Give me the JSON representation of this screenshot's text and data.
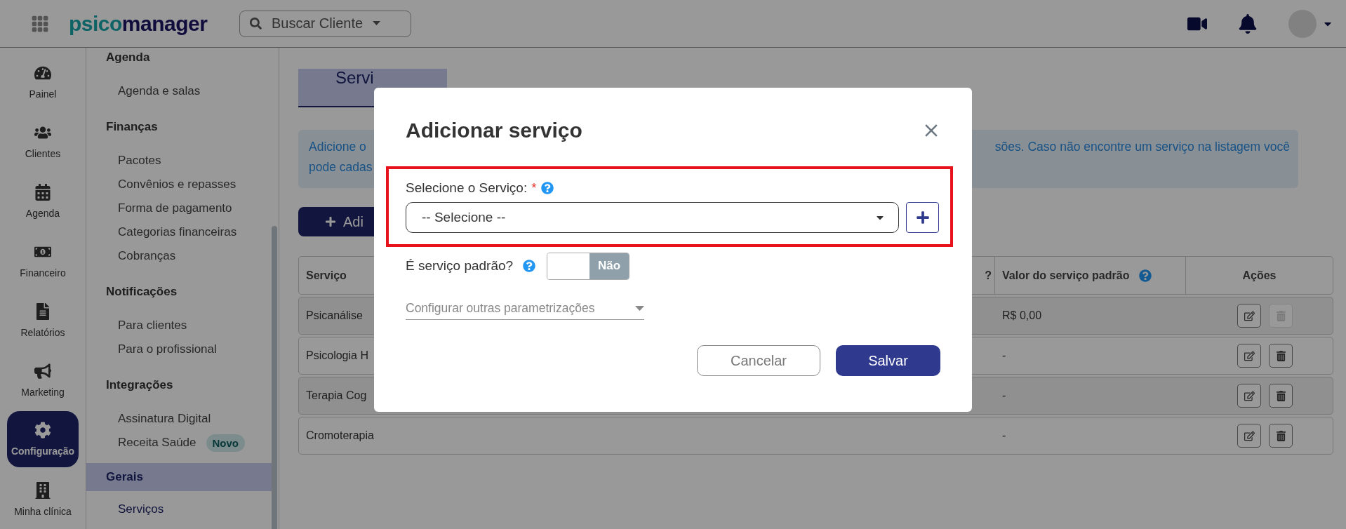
{
  "topbar": {
    "logo": {
      "lead": "psico",
      "tail": "manager"
    },
    "search": {
      "placeholder": "Buscar Cliente"
    }
  },
  "nav": [
    {
      "label": "Painel",
      "selected": false
    },
    {
      "label": "Clientes",
      "selected": false
    },
    {
      "label": "Agenda",
      "selected": false
    },
    {
      "label": "Financeiro",
      "selected": false
    },
    {
      "label": "Relatórios",
      "selected": false
    },
    {
      "label": "Marketing",
      "selected": false
    },
    {
      "label": "Configuração",
      "selected": true
    },
    {
      "label": "Minha clínica",
      "selected": false
    }
  ],
  "sidebar": [
    {
      "title": "Agenda",
      "selected": false,
      "items": [
        {
          "label": "Agenda e salas",
          "selected": false
        }
      ]
    },
    {
      "title": "Finanças",
      "selected": false,
      "items": [
        {
          "label": "Pacotes",
          "selected": false
        },
        {
          "label": "Convênios e repasses",
          "selected": false
        },
        {
          "label": "Forma de pagamento",
          "selected": false
        },
        {
          "label": "Categorias financeiras",
          "selected": false
        },
        {
          "label": "Cobranças",
          "selected": false
        }
      ]
    },
    {
      "title": "Notificações",
      "selected": false,
      "items": [
        {
          "label": "Para clientes",
          "selected": false
        },
        {
          "label": "Para o profissional",
          "selected": false
        }
      ]
    },
    {
      "title": "Integrações",
      "selected": false,
      "items": [
        {
          "label": "Assinatura Digital",
          "selected": false
        },
        {
          "label": "Receita Saúde",
          "selected": false,
          "badge": "Novo"
        }
      ]
    },
    {
      "title": "Gerais",
      "selected": true,
      "items": [
        {
          "label": "Serviços",
          "selected": true
        }
      ]
    }
  ],
  "page": {
    "tab": "Servi",
    "info_left": [
      "Adicione o",
      "pode cadas"
    ],
    "info_right": "sões. Caso não encontre um serviço na listagem você",
    "add_button": "Adi"
  },
  "table": {
    "columns": [
      {
        "label": "Serviço",
        "help": false
      },
      {
        "label": "?",
        "help": false
      },
      {
        "label": "Valor do serviço padrão",
        "help": true
      },
      {
        "label": "Ações",
        "help": false
      }
    ],
    "rows": [
      {
        "service": "Psicanálise",
        "value": "R$ 0,00",
        "delete_disabled": true
      },
      {
        "service": "Psicologia H",
        "value": "-",
        "delete_disabled": false
      },
      {
        "service": "Terapia Cog",
        "value": "-",
        "delete_disabled": false
      },
      {
        "service": "Cromoterapia",
        "value": "-",
        "delete_disabled": false
      }
    ]
  },
  "modal": {
    "title": "Adicionar serviço",
    "select_label": "Selecione o Serviço:",
    "required_mark": "*",
    "select_value": "-- Selecione --",
    "default_service": {
      "label": "É serviço padrão?",
      "on": false,
      "state_text": "Não"
    },
    "more_settings": "Configurar outras parametrizações",
    "buttons": {
      "cancel": "Cancelar",
      "save": "Salvar"
    }
  }
}
